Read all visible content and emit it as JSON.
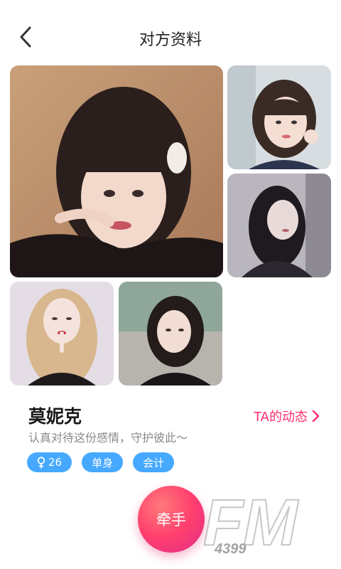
{
  "header": {
    "title": "对方资料",
    "back_icon": "back-chevron-icon"
  },
  "profile": {
    "name": "莫妮克",
    "bio": "认真对待这份感情，守护彼此～",
    "dynamics_link": "TA的动态",
    "tags": {
      "age": "26",
      "gender_icon": "female-icon",
      "status": "单身",
      "job": "会计"
    }
  },
  "action": {
    "hold_hands": "牵手"
  },
  "watermark": {
    "brand": "FM",
    "number": "4399"
  },
  "colors": {
    "accent_pink": "#ff2f6d",
    "tag_blue": "#46a9ff"
  }
}
